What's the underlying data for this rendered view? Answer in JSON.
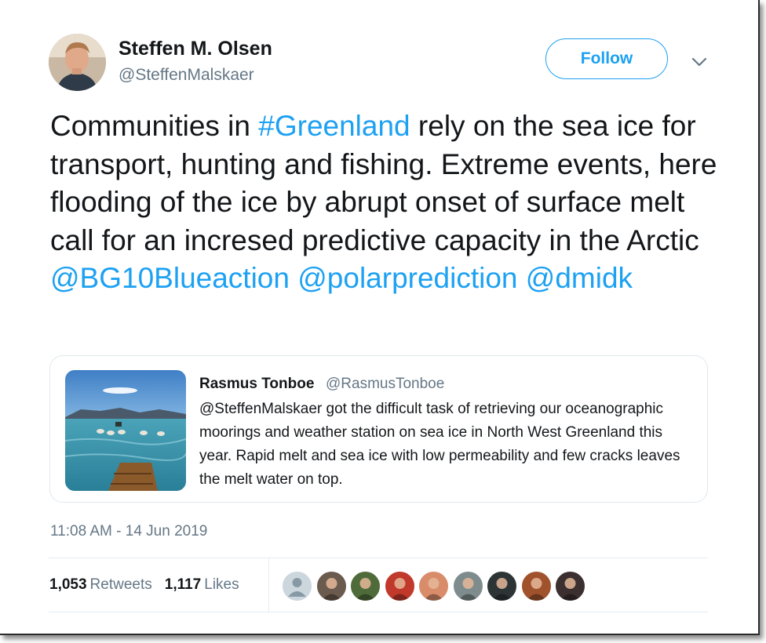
{
  "author": {
    "name": "Steffen M. Olsen",
    "handle": "@SteffenMalskaer"
  },
  "follow_label": "Follow",
  "tweet": {
    "segments": [
      {
        "text": "Communities in ",
        "link": false
      },
      {
        "text": "#Greenland",
        "link": true
      },
      {
        "text": " rely on the sea ice for transport, hunting and fishing. Extreme events, here flooding of the ice by abrupt onset of surface melt call for an incresed predictive capacity in the Arctic ",
        "link": false
      },
      {
        "text": "@BG10Blueaction",
        "link": true
      },
      {
        "text": " ",
        "link": false
      },
      {
        "text": "@polarprediction",
        "link": true
      },
      {
        "text": " ",
        "link": false
      },
      {
        "text": "@dmidk",
        "link": true
      }
    ]
  },
  "quote": {
    "name": "Rasmus Tonboe",
    "handle": "@RasmusTonboe",
    "text": "@SteffenMalskaer got the difficult task of retrieving our oceanographic moorings and weather station on sea ice in North West Greenland this year. Rapid melt and sea ice with low permeability and few cracks leaves the melt water on top."
  },
  "timestamp": "11:08 AM - 14 Jun 2019",
  "stats": {
    "retweets_count": "1,053",
    "retweets_label": "Retweets",
    "likes_count": "1,117",
    "likes_label": "Likes"
  },
  "colors": {
    "accent": "#1da1f2",
    "text": "#14171a",
    "muted": "#657786"
  },
  "likers": [
    {
      "name": "default-profile-icon",
      "color": "#9aa5ad"
    },
    {
      "name": "liker-avatar-2",
      "color": "#6b5a4e"
    },
    {
      "name": "liker-avatar-3",
      "color": "#4f6b3a"
    },
    {
      "name": "liker-avatar-4",
      "color": "#c0392b"
    },
    {
      "name": "liker-avatar-5",
      "color": "#d98c6a"
    },
    {
      "name": "liker-avatar-6",
      "color": "#7f8c8d"
    },
    {
      "name": "liker-avatar-7",
      "color": "#2d3436"
    },
    {
      "name": "liker-avatar-8",
      "color": "#a0522d"
    },
    {
      "name": "liker-avatar-9",
      "color": "#3b2f2f"
    }
  ]
}
